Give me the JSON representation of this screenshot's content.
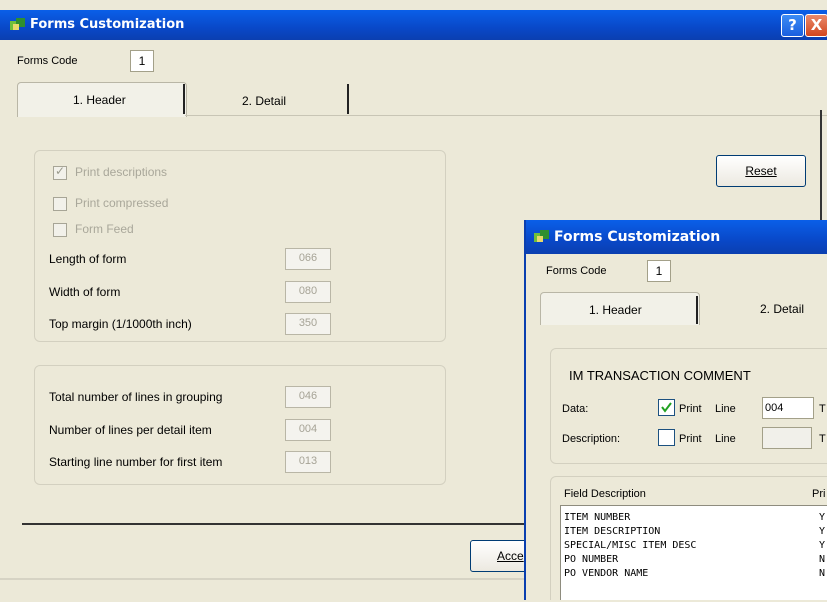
{
  "main_window": {
    "title": "Forms Customization",
    "help_button": "?",
    "close_button": "X",
    "forms_code_label": "Forms Code",
    "forms_code_value": "1",
    "tabs": [
      {
        "label": "1. Header"
      },
      {
        "label": "2. Detail"
      }
    ],
    "reset_button": "Reset",
    "accept_button": "Acce",
    "options": {
      "print_descriptions": "Print descriptions",
      "print_compressed": "Print compressed",
      "form_feed": "Form Feed"
    },
    "form_fields": [
      {
        "label": "Length of form",
        "value": "066"
      },
      {
        "label": "Width of form",
        "value": "080"
      },
      {
        "label": "Top margin  (1/1000th inch)",
        "value": "350"
      }
    ],
    "line_fields": [
      {
        "label": "Total number of lines in grouping",
        "value": "046"
      },
      {
        "label": "Number of lines per detail item",
        "value": "004"
      },
      {
        "label": "Starting line number for first item",
        "value": "013"
      }
    ]
  },
  "detail_window": {
    "title": "Forms Customization",
    "forms_code_label": "Forms Code",
    "forms_code_value": "1",
    "tabs": [
      {
        "label": "1. Header"
      },
      {
        "label": "2. Detail"
      }
    ],
    "section_title": "IM TRANSACTION COMMENT",
    "data_row": {
      "label": "Data:",
      "print_label": "Print",
      "line_label": "Line",
      "line_value": "004",
      "trail": "T"
    },
    "description_row": {
      "label": "Description:",
      "print_label": "Print",
      "line_label": "Line",
      "line_value": "",
      "trail": "T"
    },
    "table": {
      "header_field": "Field Description",
      "header_print": "Pri",
      "rows": [
        {
          "field": "ITEM NUMBER",
          "print": "Y"
        },
        {
          "field": "ITEM DESCRIPTION",
          "print": "Y"
        },
        {
          "field": "SPECIAL/MISC ITEM DESC",
          "print": "Y"
        },
        {
          "field": "PO NUMBER",
          "print": "N"
        },
        {
          "field": "PO VENDOR NAME",
          "print": "N"
        }
      ]
    }
  },
  "colors": {
    "titlebar": "#0948c8",
    "dialog_bg": "#ece9d8",
    "close_button": "#d2461e"
  }
}
